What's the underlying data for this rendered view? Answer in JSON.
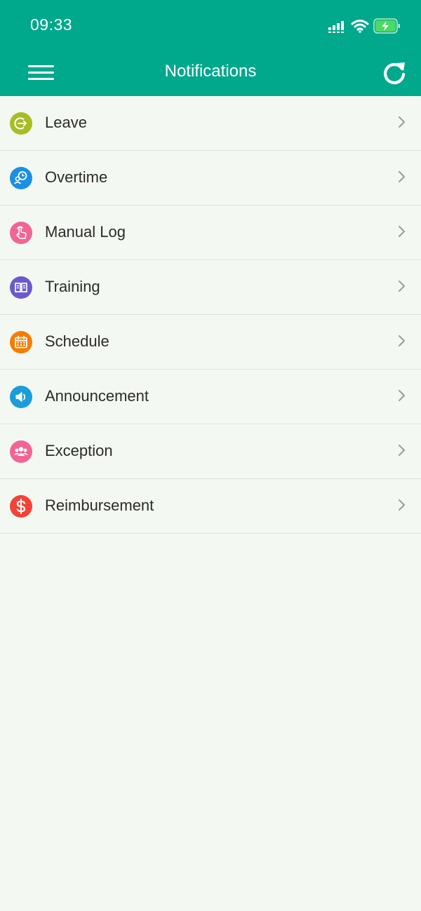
{
  "status_bar": {
    "time": "09:33"
  },
  "nav": {
    "title": "Notifications"
  },
  "items": [
    {
      "label": "Leave",
      "icon": "logout-arrow-icon",
      "color": "#a8bc24"
    },
    {
      "label": "Overtime",
      "icon": "clock-person-icon",
      "color": "#1a8fe3"
    },
    {
      "label": "Manual Log",
      "icon": "hand-tap-icon",
      "color": "#f06595"
    },
    {
      "label": "Training",
      "icon": "open-book-icon",
      "color": "#6a5acd"
    },
    {
      "label": "Schedule",
      "icon": "calendar-icon",
      "color": "#f57c00"
    },
    {
      "label": "Announcement",
      "icon": "speaker-icon",
      "color": "#1a9dd9"
    },
    {
      "label": "Exception",
      "icon": "group-icon",
      "color": "#f06595"
    },
    {
      "label": "Reimbursement",
      "icon": "dollar-icon",
      "color": "#f44336"
    }
  ],
  "colors": {
    "header": "#00a88c",
    "background": "#f4f8f2",
    "battery": "#4cd964"
  }
}
